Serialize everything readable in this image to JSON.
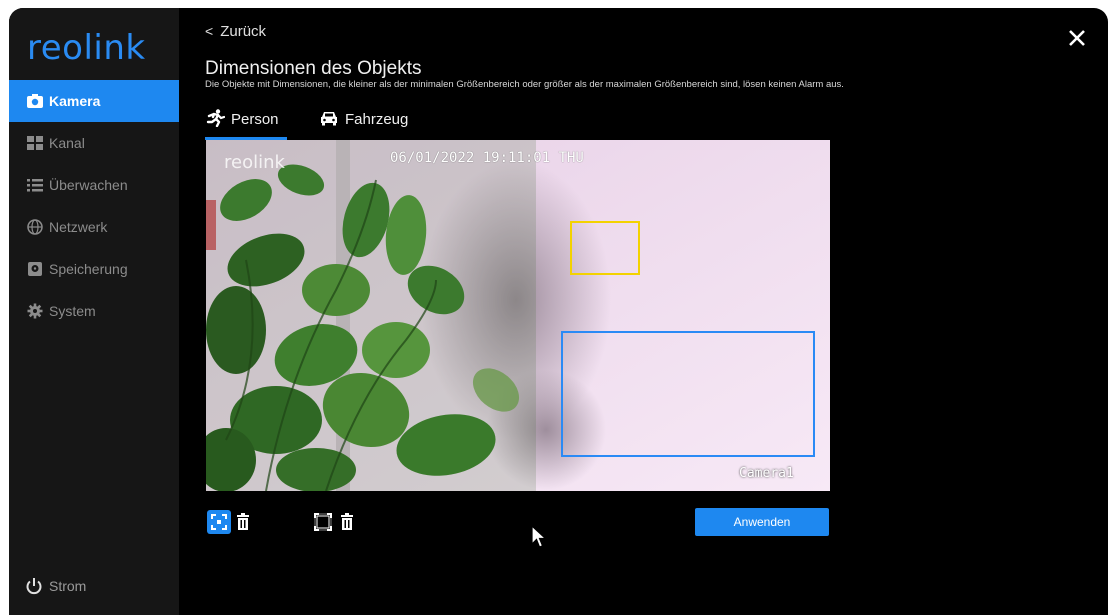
{
  "sidebar": {
    "logo": "reolink",
    "items": [
      {
        "label": "Kamera",
        "icon": "camera-icon",
        "active": true
      },
      {
        "label": "Kanal",
        "icon": "grid-icon",
        "active": false
      },
      {
        "label": "Überwachen",
        "icon": "list-icon",
        "active": false
      },
      {
        "label": "Netzwerk",
        "icon": "globe-icon",
        "active": false
      },
      {
        "label": "Speicherung",
        "icon": "storage-icon",
        "active": false
      },
      {
        "label": "System",
        "icon": "gear-icon",
        "active": false
      }
    ],
    "power_label": "Strom"
  },
  "header": {
    "back_label": "Zurück",
    "title": "Dimensionen des Objekts",
    "description": "Die Objekte mit Dimensionen, die kleiner als der minimalen Größenbereich oder größer als der maximalen Größenbereich sind, lösen keinen Alarm aus."
  },
  "tabs": [
    {
      "label": "Person",
      "icon": "running-person-icon",
      "active": true
    },
    {
      "label": "Fahrzeug",
      "icon": "car-icon",
      "active": false
    }
  ],
  "video": {
    "osd_logo": "reolink",
    "timestamp": "06/01/2022 19:11:01 THU",
    "camera_name": "Camera1",
    "min_box_color": "#f3d200",
    "max_box_color": "#2a8af5"
  },
  "toolbar": {
    "apply_label": "Anwenden"
  },
  "colors": {
    "accent": "#1e88f0",
    "sidebar_bg": "#161616",
    "background": "#000000"
  }
}
